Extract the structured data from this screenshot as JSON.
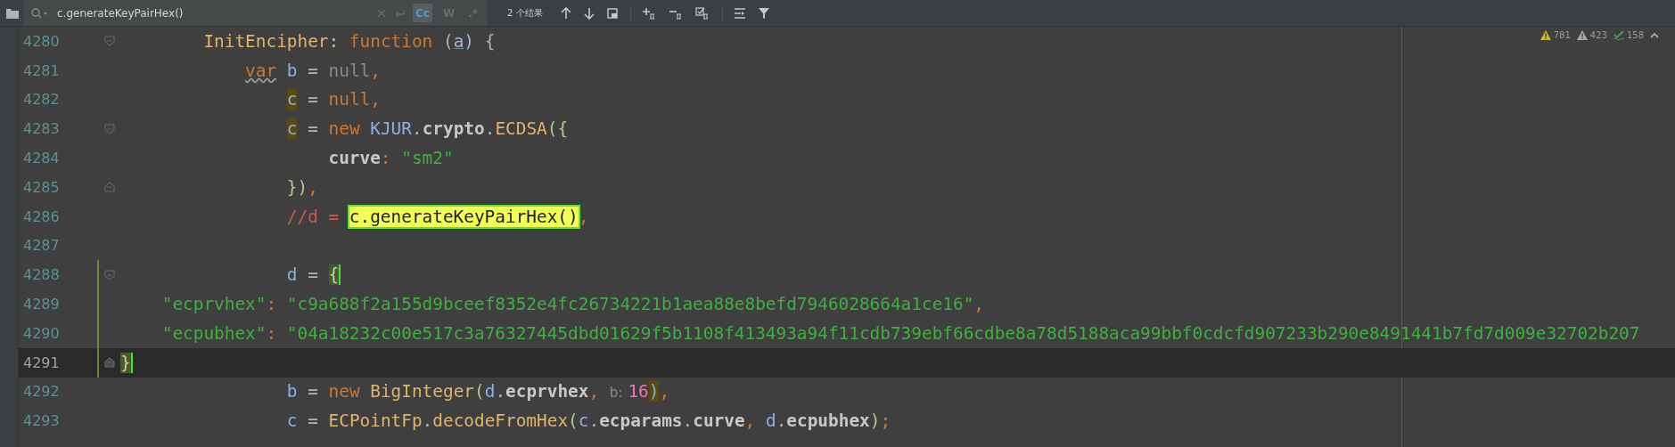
{
  "search_bar": {
    "query": "c.generateKeyPairHex()",
    "toggles": [
      {
        "label": "Cc",
        "selected": true
      },
      {
        "label": "W",
        "selected": false
      },
      {
        "label": ".*",
        "selected": false
      }
    ],
    "result_count": "2 个结果"
  },
  "inspections": [
    {
      "kind": "warning",
      "count": "781"
    },
    {
      "kind": "weak",
      "count": "423"
    },
    {
      "kind": "typo",
      "count": "158"
    }
  ],
  "lines": [
    {
      "number": "4280",
      "current": false,
      "changed": false,
      "fold_start": true,
      "fold_end": false,
      "tokens": [
        {
          "kind": "gold",
          "text": "        InitEncipher:"
        },
        {
          "kind": "kw",
          "text": " function"
        },
        {
          "kind": "plain",
          "text": " ("
        },
        {
          "kind": "param",
          "text": "a"
        },
        {
          "kind": "plain",
          "text": ") {"
        }
      ]
    },
    {
      "number": "4281",
      "current": false,
      "changed": false,
      "tokens": [
        {
          "kind": "kwwarn",
          "text": "            var"
        },
        {
          "kind": "var",
          "text": " b"
        },
        {
          "kind": "plain",
          "text": " = "
        },
        {
          "kind": "gray",
          "text": "null"
        },
        {
          "kind": "kw",
          "text": ","
        }
      ]
    },
    {
      "number": "4282",
      "current": false,
      "changed": false,
      "tokens": [
        {
          "kind": "usage",
          "text": "                c"
        },
        {
          "kind": "plain",
          "text": " = "
        },
        {
          "kind": "kw",
          "text": "null,"
        }
      ]
    },
    {
      "number": "4283",
      "current": false,
      "changed": false,
      "fold_start": true,
      "fold_end": false,
      "tokens": [
        {
          "kind": "usage",
          "text": "                c"
        },
        {
          "kind": "plain",
          "text": " = "
        },
        {
          "kind": "kw",
          "text": "new"
        },
        {
          "kind": "var",
          "text": " KJUR"
        },
        {
          "kind": "plain",
          "text": "."
        },
        {
          "kind": "member",
          "text": "crypto"
        },
        {
          "kind": "plain",
          "text": "."
        },
        {
          "kind": "gold",
          "text": "ECDSA"
        },
        {
          "kind": "paren",
          "text": "({"
        }
      ]
    },
    {
      "number": "4284",
      "current": false,
      "changed": false,
      "tokens": [
        {
          "kind": "member",
          "text": "                    curve"
        },
        {
          "kind": "kw",
          "text": ":"
        },
        {
          "kind": "str",
          "text": " \"sm2\""
        }
      ]
    },
    {
      "number": "4285",
      "current": false,
      "changed": false,
      "fold_start": false,
      "fold_end": true,
      "tokens": [
        {
          "kind": "paren",
          "text": "                })"
        },
        {
          "kind": "kw",
          "text": ","
        }
      ]
    },
    {
      "number": "4286",
      "current": false,
      "changed": false,
      "tokens": [
        {
          "kind": "comment",
          "text": "                //d = "
        },
        {
          "kind": "match",
          "text": "c.generateKeyPairHex()"
        },
        {
          "kind": "kw",
          "text": ","
        }
      ]
    },
    {
      "number": "4287",
      "current": false,
      "changed": false
    },
    {
      "number": "4288",
      "current": false,
      "changed": true,
      "fold_start": true,
      "fold_end": false,
      "tokens": [
        {
          "kind": "var",
          "text": "                d"
        },
        {
          "kind": "plain",
          "text": " = "
        },
        {
          "kind": "brace",
          "text": "{"
        }
      ]
    },
    {
      "number": "4289",
      "current": false,
      "changed": true,
      "tokens": [
        {
          "kind": "str",
          "text": "    \"ecprvhex\""
        },
        {
          "kind": "kw",
          "text": ":"
        },
        {
          "kind": "str",
          "text": " \"c9a688f2a155d9bceef8352e4fc26734221b1aea88e8befd7946028664a1ce16\""
        },
        {
          "kind": "kw",
          "text": ","
        }
      ]
    },
    {
      "number": "4290",
      "current": false,
      "changed": true,
      "tokens": [
        {
          "kind": "str",
          "text": "    \"ecpubhex\""
        },
        {
          "kind": "kw",
          "text": ":"
        },
        {
          "kind": "str",
          "text": " \"04a18232c00e517c3a76327445dbd01629f5b1108f413493a94f11cdb739ebf66cdbe8a78d5188aca99bbf0cdcfd907233b290e8491441b7fd7d009e32702b207"
        }
      ]
    },
    {
      "number": "4291",
      "current": true,
      "changed": true,
      "fold_start": false,
      "fold_end": true,
      "tokens": [
        {
          "kind": "brace",
          "text": "}"
        }
      ]
    },
    {
      "number": "4292",
      "current": false,
      "changed": false,
      "tokens": [
        {
          "kind": "var",
          "text": "                b"
        },
        {
          "kind": "plain",
          "text": " = "
        },
        {
          "kind": "kw",
          "text": "new"
        },
        {
          "kind": "gold",
          "text": " BigInteger"
        },
        {
          "kind": "paren",
          "text": "("
        },
        {
          "kind": "var",
          "text": "d"
        },
        {
          "kind": "plain",
          "text": "."
        },
        {
          "kind": "member",
          "text": "ecprvhex"
        },
        {
          "kind": "kw",
          "text": ","
        },
        {
          "kind": "hint",
          "text": " b:"
        },
        {
          "kind": "num",
          "text": "16"
        },
        {
          "kind": "usage",
          "text": ")"
        },
        {
          "kind": "kw",
          "text": ","
        }
      ]
    },
    {
      "number": "4293",
      "current": false,
      "changed": false,
      "tokens": [
        {
          "kind": "var",
          "text": "                c"
        },
        {
          "kind": "plain",
          "text": " = "
        },
        {
          "kind": "gold",
          "text": "ECPointFp"
        },
        {
          "kind": "plain",
          "text": "."
        },
        {
          "kind": "gold",
          "text": "decodeFromHex"
        },
        {
          "kind": "paren",
          "text": "("
        },
        {
          "kind": "var",
          "text": "c"
        },
        {
          "kind": "plain",
          "text": "."
        },
        {
          "kind": "member",
          "text": "ecparams"
        },
        {
          "kind": "plain",
          "text": "."
        },
        {
          "kind": "member",
          "text": "curve"
        },
        {
          "kind": "kw",
          "text": ","
        },
        {
          "kind": "var",
          "text": " d"
        },
        {
          "kind": "plain",
          "text": "."
        },
        {
          "kind": "member",
          "text": "ecpubhex"
        },
        {
          "kind": "paren",
          "text": ")"
        },
        {
          "kind": "kw",
          "text": ";"
        }
      ]
    }
  ]
}
